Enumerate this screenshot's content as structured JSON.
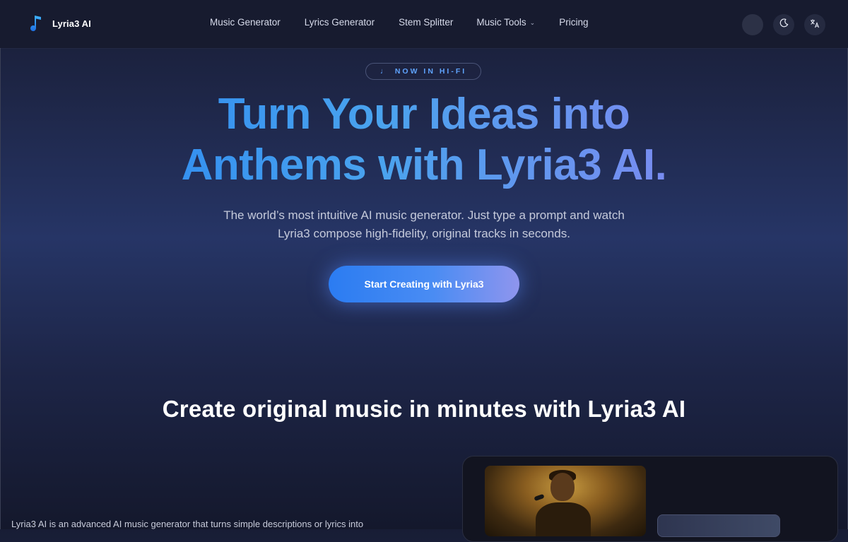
{
  "brand": {
    "name": "Lyria3 AI",
    "logo_icon": "music-note-icon",
    "accent": "#2ea0ff"
  },
  "nav": {
    "links": [
      {
        "label": "Music Generator"
      },
      {
        "label": "Lyrics Generator"
      },
      {
        "label": "Stem Splitter"
      },
      {
        "label": "Music Tools",
        "dropdown": true
      },
      {
        "label": "Pricing"
      }
    ],
    "actions": {
      "avatar": "avatar",
      "theme_icon": "moon-icon",
      "language_icon": "translate-icon"
    }
  },
  "hero": {
    "badge": "NOW IN HI-FI",
    "title_line1": "Turn Your Ideas into",
    "title_line2": "Anthems with Lyria3 AI.",
    "subtitle": "The world’s most intuitive AI music generator. Just type a prompt and watch Lyria3 compose high-fidelity, original tracks in seconds.",
    "cta_label": "Start Creating with Lyria3"
  },
  "section": {
    "title": "Create original music in minutes with Lyria3 AI",
    "body": "Lyria3 AI is an advanced AI music generator that turns simple descriptions or lyrics into"
  },
  "colors": {
    "title_gradient_start": "#2f8cf0",
    "title_gradient_end": "#9a8ff2",
    "cta_start": "#2b7cf2",
    "cta_end": "#8f95ee"
  }
}
